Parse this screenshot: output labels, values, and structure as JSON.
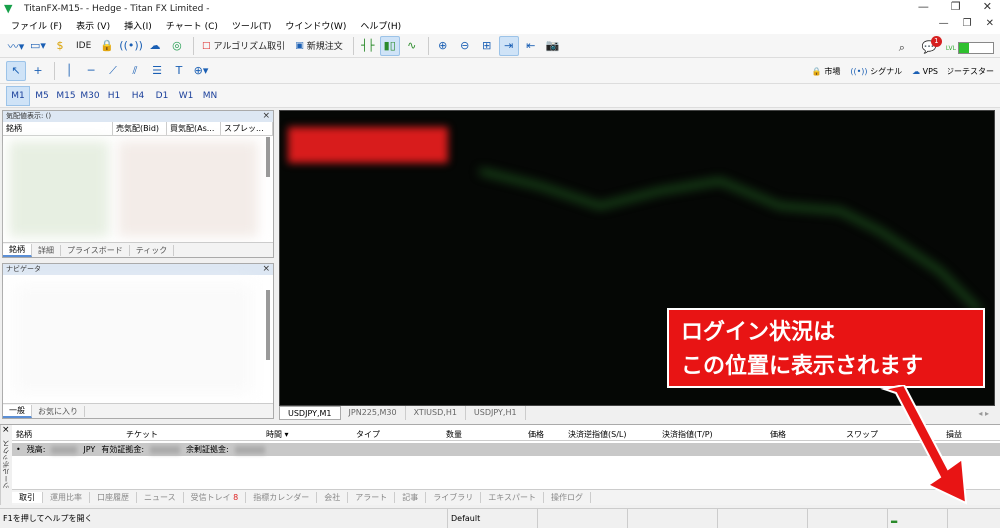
{
  "title": {
    "text": "TitanFX-M15- - Hedge - Titan FX Limited -"
  },
  "menu": [
    "ファイル (F)",
    "表示 (V)",
    "挿入(I)",
    "チャート (C)",
    "ツール(T)",
    "ウインドウ(W)",
    "ヘルプ(H)"
  ],
  "toolbar1": {
    "ide": "IDE",
    "algo": "アルゴリズム取引",
    "neworder": "新規注文"
  },
  "notif_count": "1",
  "signal_label": "LVL",
  "timeframes": [
    "M1",
    "M5",
    "M15",
    "M30",
    "H1",
    "H4",
    "D1",
    "W1",
    "MN"
  ],
  "market_watch": {
    "title": "気配値表示: ()",
    "cols": [
      "銘柄",
      "売気配(Bid)",
      "買気配(As...",
      "スプレッ..."
    ],
    "tabs": [
      "銘柄",
      "詳細",
      "プライスボード",
      "ティック"
    ]
  },
  "navigator": {
    "title": "ナビゲータ",
    "tabs": [
      "一般",
      "お気に入り"
    ]
  },
  "chart_tabs": [
    "USDJPY,M1",
    "JPN225,M30",
    "XTIUSD,H1",
    "USDJPY,H1"
  ],
  "terminal": {
    "side": "ツールボックス",
    "cols": [
      "銘柄",
      "チケット",
      "時間",
      "タイプ",
      "数量",
      "価格",
      "決済逆指値(S/L)",
      "決済指値(T/P)",
      "価格",
      "スワップ",
      "損益"
    ],
    "row": {
      "bullet": "•",
      "label": "残高:",
      "ccy": "JPY",
      "eq": "有効証拠金:",
      "free": "余剰証拠金:"
    },
    "tabs": [
      "取引",
      "運用比率",
      "口座履歴",
      "ニュース",
      "受信トレイ",
      "指標カレンダー",
      "会社",
      "アラート",
      "記事",
      "ライブラリ",
      "エキスパート",
      "操作ログ"
    ],
    "inbox_count": "8",
    "right": [
      "市場",
      "シグナル",
      "VPS",
      "ストラテジーテスター"
    ]
  },
  "status": {
    "help": "F1を押してヘルプを開く",
    "profile": "Default"
  },
  "callout": {
    "line1": "ログイン状況は",
    "line2": "この位置に表示されます"
  }
}
